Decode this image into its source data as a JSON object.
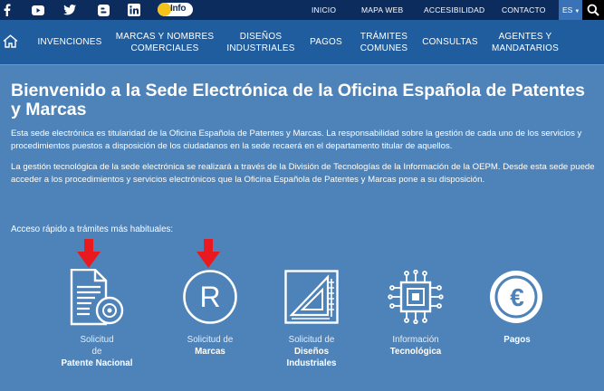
{
  "top_bar": {
    "social_icons": [
      "facebook-icon",
      "youtube-icon",
      "twitter-icon",
      "blogger-icon",
      "linkedin-icon"
    ],
    "info_badge": "Info",
    "links": [
      "INICIO",
      "MAPA WEB",
      "ACCESIBILIDAD",
      "CONTACTO"
    ],
    "language": "ES"
  },
  "nav": {
    "items": [
      {
        "line1": "INVENCIONES",
        "line2": ""
      },
      {
        "line1": "MARCAS Y NOMBRES",
        "line2": "COMERCIALES"
      },
      {
        "line1": "DISEÑOS",
        "line2": "INDUSTRIALES"
      },
      {
        "line1": "PAGOS",
        "line2": ""
      },
      {
        "line1": "TRÁMITES",
        "line2": "COMUNES"
      },
      {
        "line1": "CONSULTAS",
        "line2": ""
      },
      {
        "line1": "AGENTES Y",
        "line2": "MANDATARIOS"
      }
    ]
  },
  "main": {
    "title": "Bienvenido a la Sede Electrónica de la Oficina Española de Patentes y Marcas",
    "paragraph1": "Esta sede electrónica es titularidad de la Oficina Española de Patentes y Marcas. La responsabilidad sobre la gestión de cada uno de los servicios y procedimientos puestos a disposición de los ciudadanos en la sede recaerá en el departamento titular de aquellos.",
    "paragraph2": "La gestión tecnológica de la sede electrónica se realizará a través de la División de Tecnologías de la Información de la OEPM. Desde esta sede puede acceder a los procedimientos y servicios electrónicos que la Oficina Española de Patentes y Marcas pone a su disposición.",
    "quick_access_label": "Acceso rápido a trámites más habituales:"
  },
  "tiles": [
    {
      "icon": "patent-document-icon",
      "line1": "Solicitud",
      "line2": "de",
      "bold": "Patente Nacional",
      "bold2": "",
      "arrow": true
    },
    {
      "icon": "registered-mark-icon",
      "line1": "Solicitud de",
      "line2": "",
      "bold": "Marcas",
      "bold2": "",
      "arrow": true
    },
    {
      "icon": "design-drawing-icon",
      "line1": "Solicitud de",
      "line2": "",
      "bold": "Diseños",
      "bold2": "Industriales",
      "arrow": false
    },
    {
      "icon": "chip-icon",
      "line1": "Información",
      "line2": "",
      "bold": "Tecnológica",
      "bold2": "",
      "arrow": false
    },
    {
      "icon": "euro-icon",
      "line1": "",
      "line2": "",
      "bold": "Pagos",
      "bold2": "",
      "arrow": false
    }
  ],
  "colors": {
    "top_bar": "#0c2c5d",
    "nav_bar": "#1f5d9f",
    "background": "#4d83b9",
    "arrow": "#e8191f"
  }
}
